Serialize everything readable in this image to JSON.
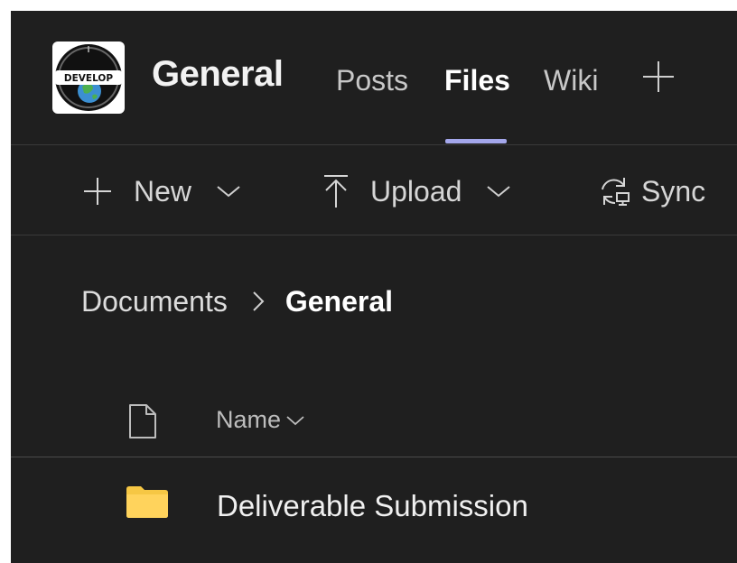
{
  "header": {
    "logo_text": "DEVELOP",
    "channel_title": "General",
    "tabs": [
      {
        "label": "Posts",
        "active": false
      },
      {
        "label": "Files",
        "active": true
      },
      {
        "label": "Wiki",
        "active": false
      }
    ],
    "add_tab_icon": "plus-icon",
    "active_tab_color": "#a4a7eb"
  },
  "toolbar": {
    "new_label": "New",
    "upload_label": "Upload",
    "sync_label": "Sync"
  },
  "breadcrumb": {
    "root": "Documents",
    "separator_icon": "chevron-right-icon",
    "current": "General"
  },
  "table": {
    "file_type_icon": "document-icon",
    "name_header": "Name",
    "rows": [
      {
        "type": "folder",
        "name": "Deliverable Submission",
        "icon": "folder-icon",
        "icon_color": "#f6c744"
      }
    ]
  }
}
